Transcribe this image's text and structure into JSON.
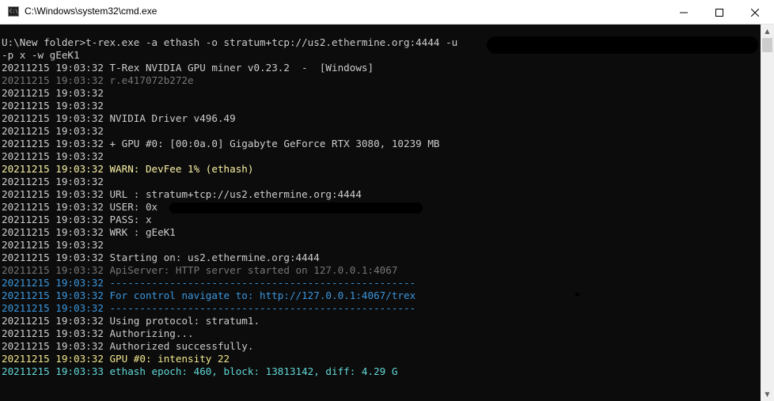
{
  "window": {
    "title": "C:\\Windows\\system32\\cmd.exe",
    "icon_text": "C:\\_",
    "minimize_icon": "minimize-icon",
    "maximize_icon": "maximize-icon",
    "close_icon": "close-icon"
  },
  "terminal": {
    "background": "#0c0c0c",
    "lines": [
      {
        "text": "U:\\New folder>t-rex.exe -a ethash -o stratum+tcp://us2.ethermine.org:4444 -u",
        "color": "default"
      },
      {
        "text": "-p x -w gEeK1",
        "color": "default"
      },
      {
        "text": "20211215 19:03:32 T-Rex NVIDIA GPU miner v0.23.2  -  [Windows]",
        "color": "default"
      },
      {
        "text": "20211215 19:03:32 r.e417072b272e",
        "color": "gray"
      },
      {
        "text": "20211215 19:03:32",
        "color": "default"
      },
      {
        "text": "20211215 19:03:32",
        "color": "default"
      },
      {
        "text": "20211215 19:03:32 NVIDIA Driver v496.49",
        "color": "default"
      },
      {
        "text": "20211215 19:03:32",
        "color": "default"
      },
      {
        "text": "20211215 19:03:32 + GPU #0: [00:0a.0] Gigabyte GeForce RTX 3080, 10239 MB",
        "color": "default"
      },
      {
        "text": "20211215 19:03:32",
        "color": "default"
      },
      {
        "text": "20211215 19:03:32 WARN: DevFee 1% (ethash)",
        "color": "warn"
      },
      {
        "text": "20211215 19:03:32",
        "color": "default"
      },
      {
        "text": "20211215 19:03:32 URL : stratum+tcp://us2.ethermine.org:4444",
        "color": "default"
      },
      {
        "text": "20211215 19:03:32 USER: 0x",
        "color": "default"
      },
      {
        "text": "20211215 19:03:32 PASS: x",
        "color": "default"
      },
      {
        "text": "20211215 19:03:32 WRK : gEeK1",
        "color": "default"
      },
      {
        "text": "20211215 19:03:32",
        "color": "default"
      },
      {
        "text": "20211215 19:03:32 Starting on: us2.ethermine.org:4444",
        "color": "default"
      },
      {
        "text": "20211215 19:03:32 ApiServer: HTTP server started on 127.0.0.1:4067",
        "color": "gray"
      },
      {
        "text": "20211215 19:03:32 ---------------------------------------------------",
        "color": "cyan"
      },
      {
        "text": "20211215 19:03:32 For control navigate to: http://127.0.0.1:4067/trex",
        "color": "cyan"
      },
      {
        "text": "20211215 19:03:32 ---------------------------------------------------",
        "color": "cyan"
      },
      {
        "text": "20211215 19:03:32 Using protocol: stratum1.",
        "color": "default"
      },
      {
        "text": "20211215 19:03:32 Authorizing...",
        "color": "default"
      },
      {
        "text": "20211215 19:03:32 Authorized successfully.",
        "color": "default"
      },
      {
        "text": "20211215 19:03:32 GPU #0: intensity 22",
        "color": "yellow"
      },
      {
        "text": "20211215 19:03:33 ethash epoch: 460, block: 13813142, diff: 4.29 G",
        "color": "blue"
      }
    ]
  },
  "colors": {
    "default": "#cccccc",
    "gray": "#767676",
    "warn": "#f9f1a5",
    "cyan": "#3a96dd",
    "blue": "#61d6d6",
    "yellow": "#f0e68c"
  }
}
